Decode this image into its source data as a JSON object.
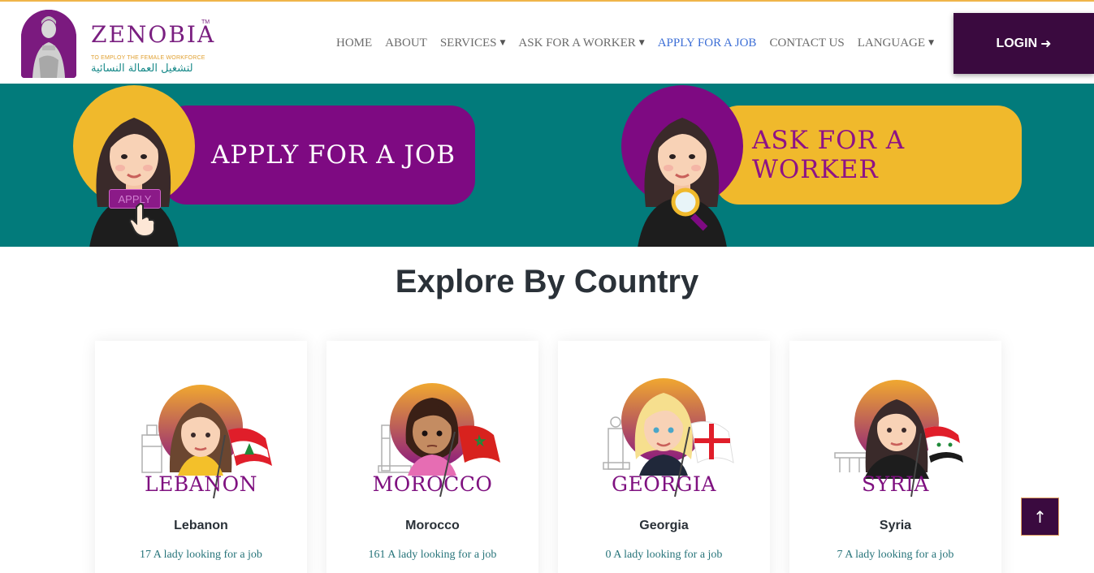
{
  "brand": {
    "name": "ZENOBIA",
    "tm": "TM",
    "tagline": "TO EMPLOY THE FEMALE WORKFORCE",
    "tagline_ar": "لتشغيل العمالة النسائية"
  },
  "nav": {
    "items": [
      {
        "label": "HOME",
        "has_dropdown": false,
        "active": false
      },
      {
        "label": "ABOUT",
        "has_dropdown": false,
        "active": false
      },
      {
        "label": "SERVICES",
        "has_dropdown": true,
        "active": false
      },
      {
        "label": "ASK FOR A WORKER",
        "has_dropdown": true,
        "active": false
      },
      {
        "label": "APPLY FOR A JOB",
        "has_dropdown": false,
        "active": true
      },
      {
        "label": "CONTACT US",
        "has_dropdown": false,
        "active": false
      },
      {
        "label": "LANGUAGE",
        "has_dropdown": true,
        "active": false
      }
    ],
    "login_label": "LOGIN",
    "login_icon": "arrow-right-icon"
  },
  "banner": {
    "apply_label": "APPLY FOR A JOB",
    "apply_tag": "APPLY",
    "ask_label": "ASK FOR A WORKER"
  },
  "explore": {
    "title": "Explore By Country",
    "cards": [
      {
        "word": "LEBANON",
        "name": "Lebanon",
        "count_text": "17 A lady looking for a job"
      },
      {
        "word": "MOROCCO",
        "name": "Morocco",
        "count_text": "161 A lady looking for a job"
      },
      {
        "word": "GEORGIA",
        "name": "Georgia",
        "count_text": "0 A lady looking for a job"
      },
      {
        "word": "SYRIA",
        "name": "Syria",
        "count_text": "7 A lady looking for a job"
      }
    ]
  },
  "scroll_top": {
    "icon": "arrow-up-icon",
    "glyph": "↑"
  },
  "colors": {
    "brand_purple": "#7e0a82",
    "dark_purple": "#3a0a3f",
    "teal": "#027b7b",
    "gold": "#f0b92c",
    "nav_active": "#3d6fd6"
  }
}
